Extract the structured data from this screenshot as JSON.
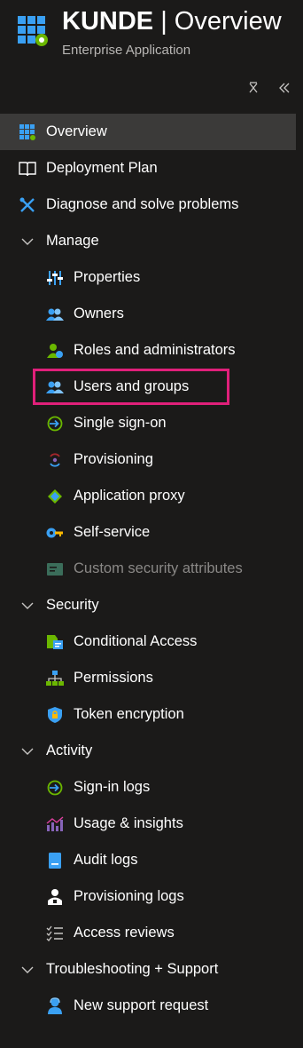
{
  "header": {
    "app_name": "KUNDE",
    "separator": "|",
    "page": "Overview",
    "subtitle": "Enterprise Application"
  },
  "toolbar": {
    "pin_icon": "pin-icon",
    "collapse_icon": "collapse-icon"
  },
  "nav": {
    "overview": "Overview",
    "deployment_plan": "Deployment Plan",
    "diagnose": "Diagnose and solve problems",
    "manage": "Manage",
    "properties": "Properties",
    "owners": "Owners",
    "roles": "Roles and administrators",
    "users_groups": "Users and groups",
    "sso": "Single sign-on",
    "provisioning": "Provisioning",
    "app_proxy": "Application proxy",
    "self_service": "Self-service",
    "custom_security": "Custom security attributes",
    "security": "Security",
    "conditional_access": "Conditional Access",
    "permissions": "Permissions",
    "token_encryption": "Token encryption",
    "activity": "Activity",
    "signin_logs": "Sign-in logs",
    "usage_insights": "Usage & insights",
    "audit_logs": "Audit logs",
    "provisioning_logs": "Provisioning logs",
    "access_reviews": "Access reviews",
    "troubleshooting": "Troubleshooting + Support",
    "support_request": "New support request"
  },
  "colors": {
    "background": "#1b1a19",
    "selected": "#3b3a39",
    "highlight": "#e0207a",
    "accent_blue": "#0078d4"
  }
}
